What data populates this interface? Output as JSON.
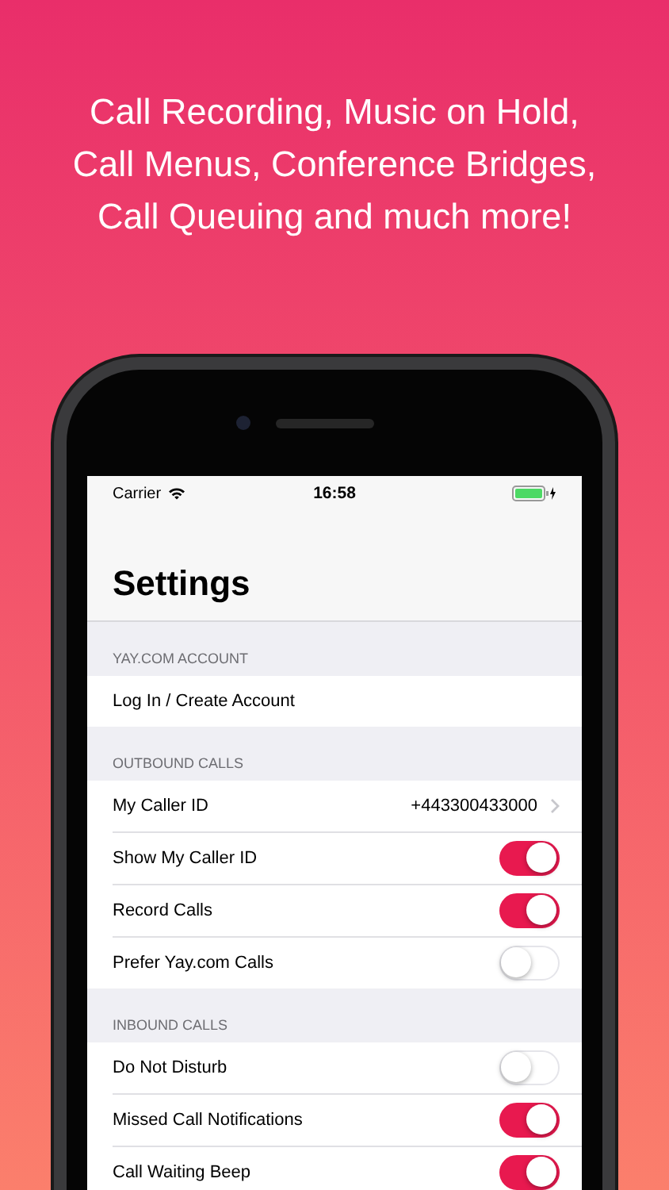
{
  "headline": "Call Recording, Music on Hold,\nCall Menus, Conference Bridges,\nCall Queuing and much more!",
  "status_bar": {
    "carrier": "Carrier",
    "time": "16:58"
  },
  "title": "Settings",
  "sections": [
    {
      "header": "YAY.COM ACCOUNT",
      "rows": [
        {
          "kind": "action",
          "label": "Log In / Create Account"
        }
      ]
    },
    {
      "header": "OUTBOUND CALLS",
      "rows": [
        {
          "kind": "detail",
          "label": "My Caller ID",
          "value": "+443300433000"
        },
        {
          "kind": "toggle",
          "label": "Show My Caller ID",
          "on": true
        },
        {
          "kind": "toggle",
          "label": "Record Calls",
          "on": true
        },
        {
          "kind": "toggle",
          "label": "Prefer Yay.com Calls",
          "on": false
        }
      ]
    },
    {
      "header": "INBOUND CALLS",
      "rows": [
        {
          "kind": "toggle",
          "label": "Do Not Disturb",
          "on": false
        },
        {
          "kind": "toggle",
          "label": "Missed Call Notifications",
          "on": true
        },
        {
          "kind": "toggle",
          "label": "Call Waiting Beep",
          "on": true
        }
      ]
    }
  ]
}
